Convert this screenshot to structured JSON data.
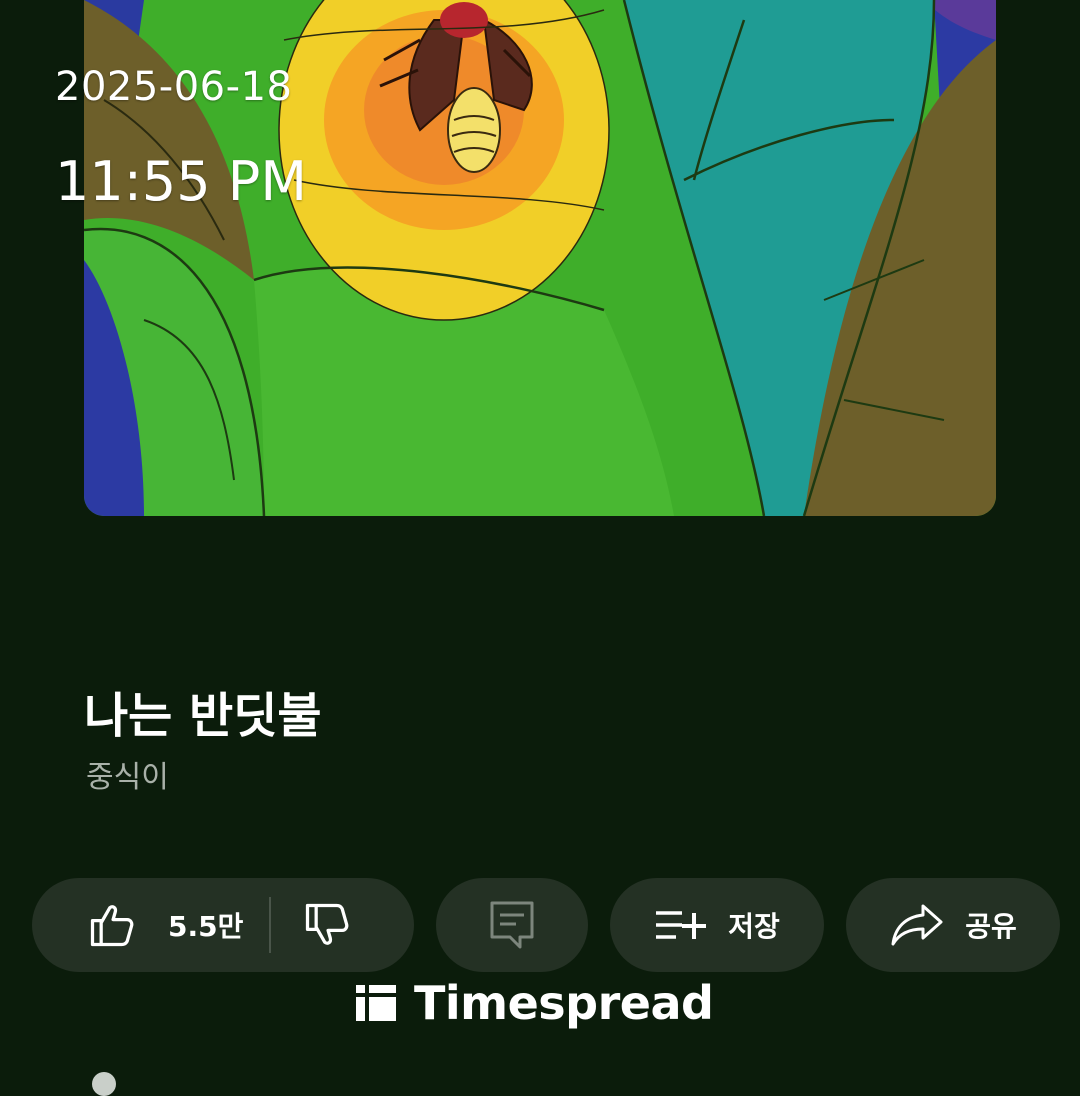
{
  "timestamp": {
    "date": "2025-06-18",
    "time": "11:55 PM"
  },
  "video": {
    "title": "나는 반딧불",
    "channel": "중식이"
  },
  "actions": {
    "like_count": "5.5만",
    "save_label": "저장",
    "share_label": "공유"
  },
  "watermark": {
    "brand": "Timespread"
  },
  "icons": [
    "thumbs-up-icon",
    "thumbs-down-icon",
    "comment-icon",
    "add-to-playlist-icon",
    "share-arrow-icon",
    "timespread-logo-icon"
  ],
  "colors": {
    "background": "#0b1c0b",
    "pill": "#243124",
    "channel_text": "#a9b1a9",
    "painting_green": "#3fae2a",
    "painting_teal": "#1f9c94",
    "painting_yellow": "#f1cf28",
    "painting_brown": "#6d5f2a",
    "painting_blue": "#2c3aa3"
  }
}
